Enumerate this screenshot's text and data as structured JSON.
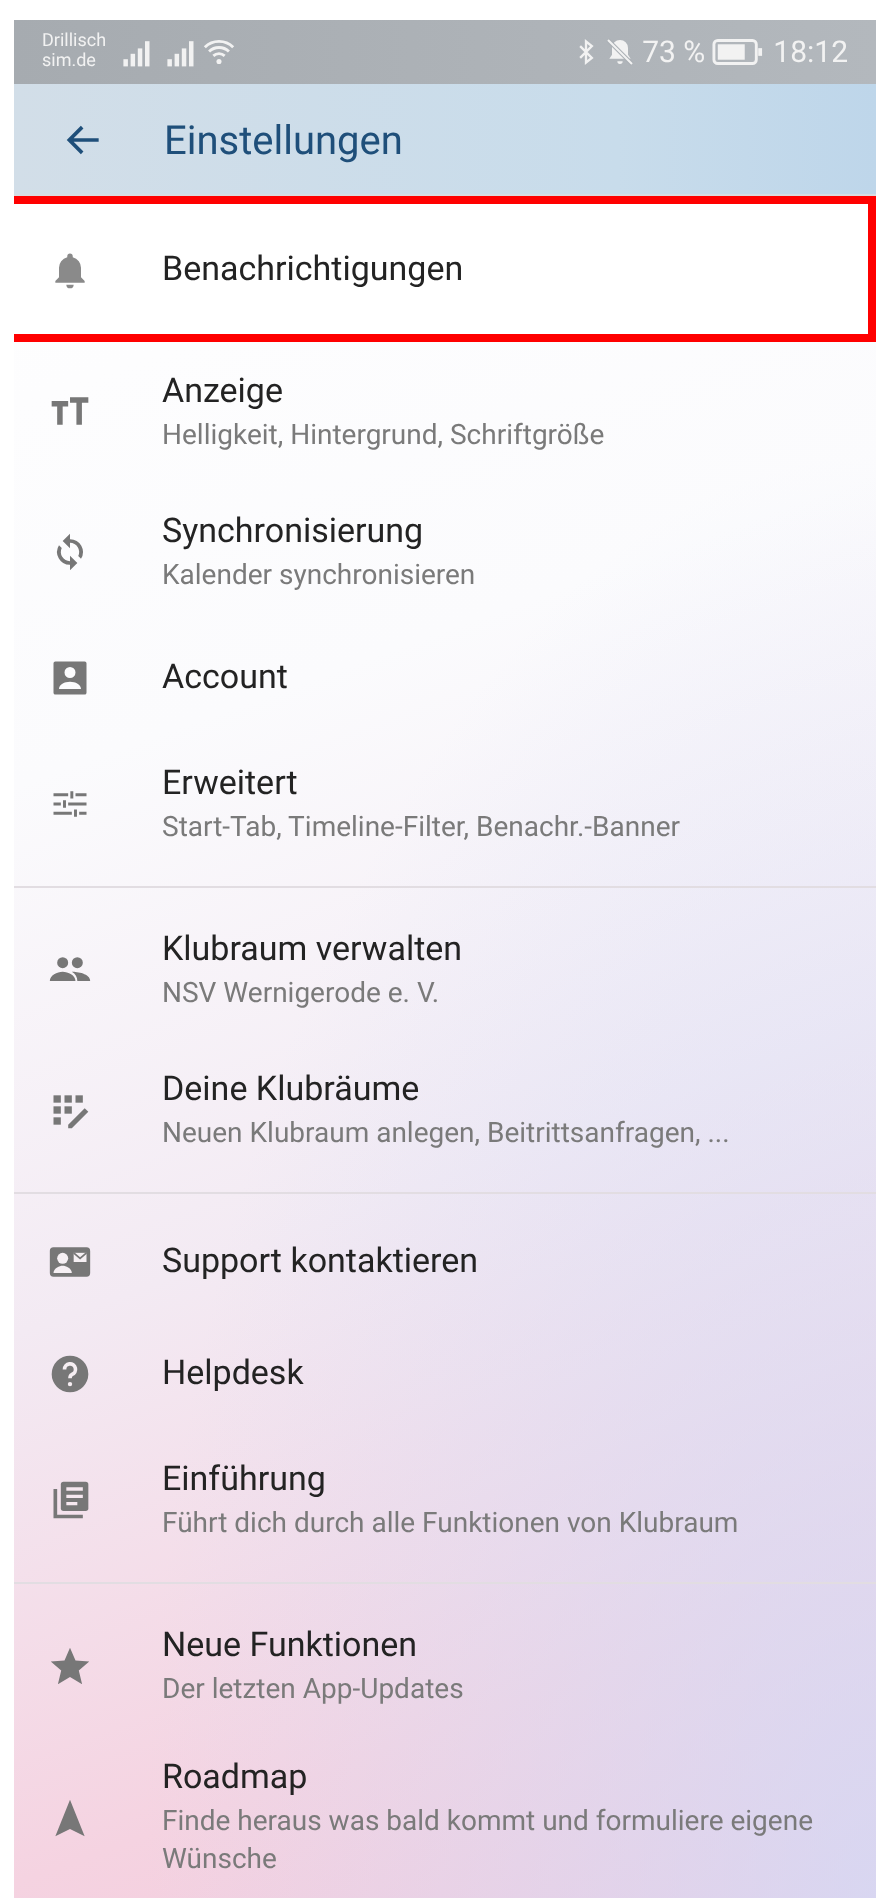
{
  "status_bar": {
    "carrier": [
      "Drillisch",
      "sim.de"
    ],
    "battery": "73 %",
    "time": "18:12"
  },
  "app_bar": {
    "title": "Einstellungen"
  },
  "sections": [
    {
      "items": [
        {
          "title": "Benachrichtigungen",
          "highlighted": true
        },
        {
          "title": "Anzeige",
          "subtitle": "Helligkeit, Hintergrund, Schriftgröße",
          "highlighted": false
        },
        {
          "title": "Synchronisierung",
          "subtitle": "Kalender synchronisieren",
          "highlighted": false
        },
        {
          "title": "Account",
          "highlighted": false
        },
        {
          "title": "Erweitert",
          "subtitle": "Start-Tab, Timeline-Filter, Benachr.-Banner",
          "highlighted": false
        }
      ]
    },
    {
      "items": [
        {
          "title": "Klubraum verwalten",
          "subtitle": "NSV Wernigerode e. V.",
          "highlighted": false
        },
        {
          "title": "Deine Klubräume",
          "subtitle": "Neuen Klubraum anlegen, Beitrittsanfragen, ...",
          "highlighted": false
        }
      ]
    },
    {
      "items": [
        {
          "title": "Support kontaktieren",
          "highlighted": false
        },
        {
          "title": "Helpdesk",
          "highlighted": false
        },
        {
          "title": "Einführung",
          "subtitle": "Führt dich durch alle Funktionen von Klubraum",
          "highlighted": false
        }
      ]
    },
    {
      "items": [
        {
          "title": "Neue Funktionen",
          "subtitle": "Der letzten App-Updates",
          "highlighted": false
        },
        {
          "title": "Roadmap",
          "subtitle": "Finde heraus was bald kommt und formuliere eigene Wünsche",
          "highlighted": false
        }
      ]
    }
  ]
}
